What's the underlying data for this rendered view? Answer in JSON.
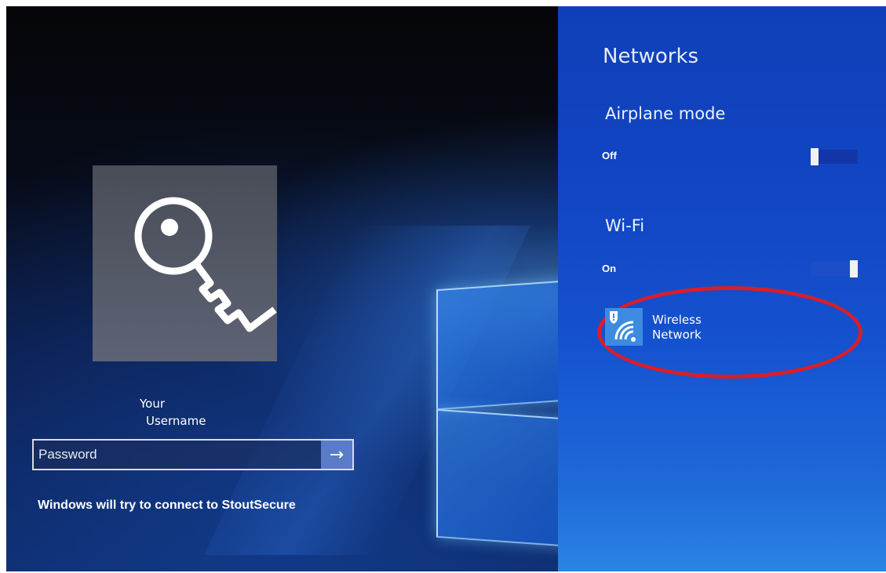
{
  "login": {
    "username_line1": "Your",
    "username_line2": "Username",
    "password_placeholder": "Password",
    "submit_icon": "arrow-right-icon",
    "connect_message": "Windows will try to connect to StoutSecure"
  },
  "networks_panel": {
    "title": "Networks",
    "airplane_mode": {
      "label": "Airplane mode",
      "state": "Off"
    },
    "wifi": {
      "label": "Wi-Fi",
      "state": "On"
    },
    "network": {
      "name_line1": "Wireless",
      "name_line2": "Network",
      "icon": "wifi-secured-icon"
    }
  },
  "colors": {
    "panel_blue": "#1246c4",
    "annotation_red": "#d81e2a",
    "submit_blue": "#5a7cc8"
  }
}
